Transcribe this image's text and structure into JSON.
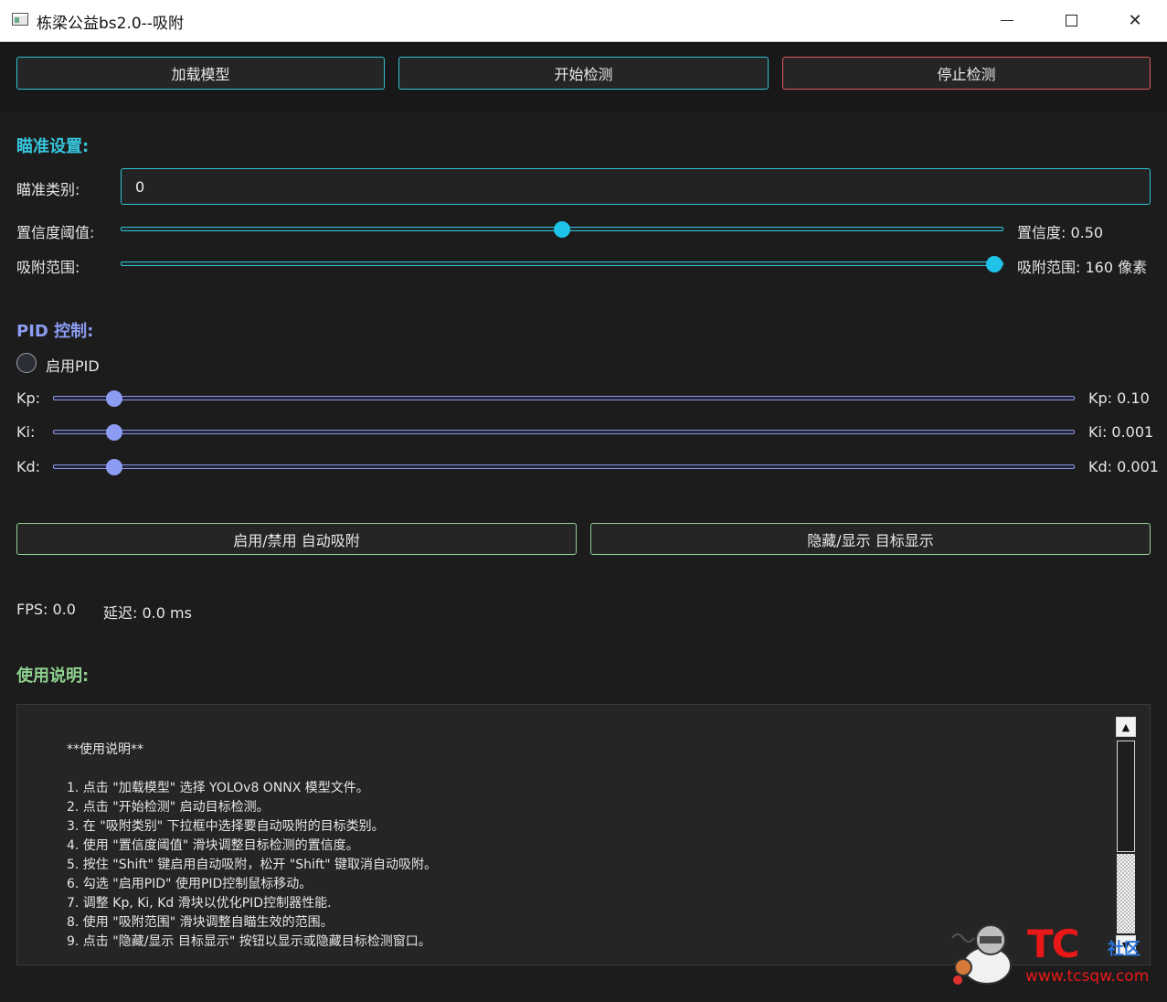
{
  "window": {
    "title": "栋梁公益bs2.0--吸附"
  },
  "toolbar": {
    "load_model": "加载模型",
    "start_detect": "开始检测",
    "stop_detect": "停止检测"
  },
  "aim": {
    "section_title": "瞄准设置:",
    "class_label": "瞄准类别:",
    "class_value": "0",
    "confidence_label": "置信度阈值:",
    "confidence_value_text": "置信度: 0.50",
    "confidence_value": 0.5,
    "range_label": "吸附范围:",
    "range_value_text": "吸附范围: 160 像素",
    "range_fraction": 0.99
  },
  "pid": {
    "section_title": "PID 控制:",
    "enable_label": "启用PID",
    "kp_label": "Kp:",
    "kp_value_text": "Kp: 0.10",
    "kp_fraction": 0.06,
    "ki_label": "Ki:",
    "ki_value_text": "Ki: 0.001",
    "ki_fraction": 0.06,
    "kd_label": "Kd:",
    "kd_value_text": "Kd: 0.001",
    "kd_fraction": 0.06
  },
  "actions": {
    "toggle_auto": "启用/禁用 自动吸附",
    "toggle_display": "隐藏/显示 目标显示"
  },
  "status": {
    "fps": "FPS: 0.0",
    "latency": "延迟: 0.0 ms"
  },
  "help": {
    "section_title": "使用说明:",
    "lines": [
      "**使用说明**",
      "",
      "1. 点击 \"加载模型\" 选择 YOLOv8 ONNX 模型文件。",
      "2. 点击 \"开始检测\" 启动目标检测。",
      "3. 在 \"吸附类别\" 下拉框中选择要自动吸附的目标类别。",
      "4. 使用 \"置信度阈值\" 滑块调整目标检测的置信度。",
      "5. 按住 \"Shift\" 键启用自动吸附，松开 \"Shift\" 键取消自动吸附。",
      "6. 勾选 \"启用PID\" 使用PID控制鼠标移动。",
      "7. 调整 Kp, Ki, Kd 滑块以优化PID控制器性能.",
      "8. 使用 \"吸附范围\" 滑块调整自瞄生效的范围。",
      "9. 点击 \"隐藏/显示 目标显示\" 按钮以显示或隐藏目标检测窗口。"
    ]
  },
  "watermark": {
    "logo": "TC",
    "brand": "社区",
    "url": "www.tcsqw.com"
  },
  "colors": {
    "accent": "#2ec4d6",
    "danger": "#e05a5a",
    "pid": "#8c9cf2",
    "help": "#8fd18f"
  }
}
